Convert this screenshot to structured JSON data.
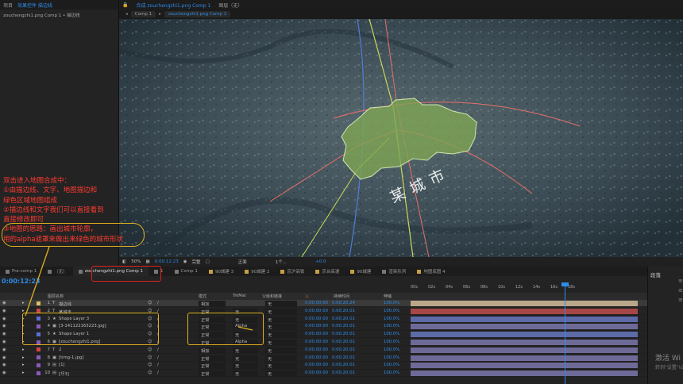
{
  "project_panel": {
    "tabs": [
      "项目",
      "效果控件 描边线"
    ],
    "active_tab": 1,
    "subtitle": "zouchengzhi1.png Comp 1 • 描边线"
  },
  "comp_panel": {
    "tab_icon": "lock-icon",
    "tabs": [
      "合成 zouchengzhi1.png Comp 1",
      "图层（无）"
    ],
    "active_tab": 0,
    "breadcrumbs": [
      "Comp 1",
      "zouchengzhi1.png Comp 1"
    ],
    "active_crumb": 1
  },
  "map": {
    "city_label": "某城市",
    "colors": {
      "region_fill": "#7fa552",
      "region_stroke": "#cfe8b0",
      "roads": "#e8706a",
      "railway": "#c8d85a",
      "river": "#4d7fd8"
    }
  },
  "viewer_bar": {
    "zoom": "50%",
    "timecode": "0:00:12:23",
    "resolution": "完整",
    "view": "正面",
    "views": "1个...",
    "exposure": "+0.0"
  },
  "timeline_tabs": [
    {
      "label": "Pre-comp 1",
      "color": "#777"
    },
    {
      "label": "（无）",
      "color": "#777"
    },
    {
      "label": "zouchengzhi1.png Comp 1",
      "color": "#777",
      "active": true
    },
    {
      "label": "1",
      "color": "#777"
    },
    {
      "label": "Comp 1",
      "color": "#777"
    },
    {
      "label": "90城建 3",
      "color": "#c8a040"
    },
    {
      "label": "90城建 2",
      "color": "#c8a040"
    },
    {
      "label": "京沪高铁",
      "color": "#c8a040"
    },
    {
      "label": "京台高速",
      "color": "#c8a040"
    },
    {
      "label": "90城建",
      "color": "#c8a040"
    },
    {
      "label": "渲染队列",
      "color": "#777"
    },
    {
      "label": "地图底图 4",
      "color": "#c8a040"
    }
  ],
  "timeline": {
    "timecode": "0:00:12:23",
    "columns": {
      "name": "图层名称",
      "mode": "模式",
      "trkmat": "TrkMat",
      "parent": "父级和链接",
      "in": "入",
      "duration": "持续时间",
      "stretch": "伸缩"
    },
    "ruler_ticks": [
      "00s",
      "02s",
      "04s",
      "06s",
      "08s",
      "10s",
      "12s",
      "14s",
      "16s",
      "18s"
    ],
    "layers": [
      {
        "num": "1",
        "name": "描边线",
        "type": "text",
        "label_color": "#e0c060",
        "mode": "相加",
        "trkmat": "",
        "parent": "无",
        "in": "0:00:00:00",
        "duration": "0:00:20:24",
        "stretch": "100.0%",
        "bar_color": "#b9a789",
        "selected": true
      },
      {
        "num": "2",
        "name": "某城市",
        "type": "text",
        "label_color": "#d24444",
        "mode": "正常",
        "trkmat": "无",
        "parent": "无",
        "in": "0:00:00:00",
        "duration": "0:00:20:01",
        "stretch": "100.0%",
        "bar_color": "#a64646"
      },
      {
        "num": "3",
        "name": "Shape Layer 3",
        "type": "shape",
        "label_color": "#5b6fd6",
        "mode": "正常",
        "trkmat": "无",
        "parent": "无",
        "in": "0:00:00:00",
        "duration": "0:00:20:01",
        "stretch": "100.0%",
        "bar_color": "#5d6aa8"
      },
      {
        "num": "4",
        "name": "[3-141122163223.jpg]",
        "type": "image",
        "label_color": "#8a5ab8",
        "mode": "正常",
        "trkmat": "Alpha",
        "parent": "无",
        "in": "0:00:00:00",
        "duration": "0:00:20:01",
        "stretch": "100.0%",
        "bar_color": "#6e6a98"
      },
      {
        "num": "5",
        "name": "Shape Layer 1",
        "type": "shape",
        "label_color": "#5b6fd6",
        "mode": "正常",
        "trkmat": "无",
        "parent": "无",
        "in": "0:00:00:00",
        "duration": "0:00:20:01",
        "stretch": "100.0%",
        "bar_color": "#5d6aa8"
      },
      {
        "num": "6",
        "name": "[zouchengzhi1.png]",
        "type": "image",
        "label_color": "#8a5ab8",
        "mode": "正常",
        "trkmat": "Alpha",
        "parent": "无",
        "in": "0:00:00:00",
        "duration": "0:00:20:01",
        "stretch": "100.0%",
        "bar_color": "#6e6a98"
      },
      {
        "num": "7",
        "name": "2",
        "type": "text",
        "label_color": "#d24444",
        "mode": "相加",
        "trkmat": "无",
        "parent": "无",
        "in": "0:00:00:00",
        "duration": "0:00:20:01",
        "stretch": "100.0%",
        "bar_color": "#6e6a98"
      },
      {
        "num": "8",
        "name": "[timg-1.jpg]",
        "type": "image",
        "label_color": "#8a5ab8",
        "mode": "正常",
        "trkmat": "无",
        "parent": "无",
        "in": "0:00:00:00",
        "duration": "0:00:20:01",
        "stretch": "100.0%",
        "bar_color": "#6e6a98"
      },
      {
        "num": "9",
        "name": "[1]",
        "type": "comp",
        "label_color": "#8a5ab8",
        "mode": "正常",
        "trkmat": "无",
        "parent": "无",
        "in": "0:00:00:00",
        "duration": "0:00:20:01",
        "stretch": "100.0%",
        "bar_color": "#6e6a98"
      },
      {
        "num": "10",
        "name": "[圩3]",
        "type": "comp",
        "label_color": "#8a5ab8",
        "mode": "正常",
        "trkmat": "无",
        "parent": "无",
        "in": "0:00:00:00",
        "duration": "0:00:20:01",
        "stretch": "100.0%",
        "bar_color": "#6e6a98"
      }
    ]
  },
  "right_panel": {
    "title": "段落"
  },
  "annotation": {
    "lines": [
      "双击进入地图合成中：",
      "①由描边线、文字、地图描边和",
      "绿色区域地图组成",
      "②描边线和文字我们可以直接看到",
      "直接修改即可",
      "③地图的思路：画出城市轮廓，",
      "用的alpha遮罩来做出来绿色的城市形状"
    ],
    "color": "#ff3b30"
  },
  "windows_watermark": {
    "line1": "激活 Wi",
    "line2": "转到\"设置\"以"
  }
}
